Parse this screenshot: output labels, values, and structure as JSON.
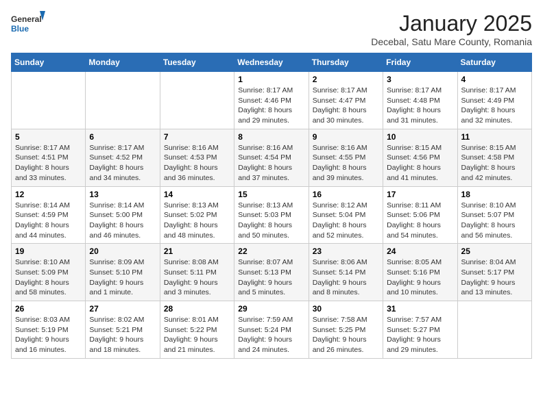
{
  "header": {
    "logo_general": "General",
    "logo_blue": "Blue",
    "title": "January 2025",
    "subtitle": "Decebal, Satu Mare County, Romania"
  },
  "days_of_week": [
    "Sunday",
    "Monday",
    "Tuesday",
    "Wednesday",
    "Thursday",
    "Friday",
    "Saturday"
  ],
  "weeks": [
    [
      {
        "day": "",
        "info": ""
      },
      {
        "day": "",
        "info": ""
      },
      {
        "day": "",
        "info": ""
      },
      {
        "day": "1",
        "info": "Sunrise: 8:17 AM\nSunset: 4:46 PM\nDaylight: 8 hours and 29 minutes."
      },
      {
        "day": "2",
        "info": "Sunrise: 8:17 AM\nSunset: 4:47 PM\nDaylight: 8 hours and 30 minutes."
      },
      {
        "day": "3",
        "info": "Sunrise: 8:17 AM\nSunset: 4:48 PM\nDaylight: 8 hours and 31 minutes."
      },
      {
        "day": "4",
        "info": "Sunrise: 8:17 AM\nSunset: 4:49 PM\nDaylight: 8 hours and 32 minutes."
      }
    ],
    [
      {
        "day": "5",
        "info": "Sunrise: 8:17 AM\nSunset: 4:51 PM\nDaylight: 8 hours and 33 minutes."
      },
      {
        "day": "6",
        "info": "Sunrise: 8:17 AM\nSunset: 4:52 PM\nDaylight: 8 hours and 34 minutes."
      },
      {
        "day": "7",
        "info": "Sunrise: 8:16 AM\nSunset: 4:53 PM\nDaylight: 8 hours and 36 minutes."
      },
      {
        "day": "8",
        "info": "Sunrise: 8:16 AM\nSunset: 4:54 PM\nDaylight: 8 hours and 37 minutes."
      },
      {
        "day": "9",
        "info": "Sunrise: 8:16 AM\nSunset: 4:55 PM\nDaylight: 8 hours and 39 minutes."
      },
      {
        "day": "10",
        "info": "Sunrise: 8:15 AM\nSunset: 4:56 PM\nDaylight: 8 hours and 41 minutes."
      },
      {
        "day": "11",
        "info": "Sunrise: 8:15 AM\nSunset: 4:58 PM\nDaylight: 8 hours and 42 minutes."
      }
    ],
    [
      {
        "day": "12",
        "info": "Sunrise: 8:14 AM\nSunset: 4:59 PM\nDaylight: 8 hours and 44 minutes."
      },
      {
        "day": "13",
        "info": "Sunrise: 8:14 AM\nSunset: 5:00 PM\nDaylight: 8 hours and 46 minutes."
      },
      {
        "day": "14",
        "info": "Sunrise: 8:13 AM\nSunset: 5:02 PM\nDaylight: 8 hours and 48 minutes."
      },
      {
        "day": "15",
        "info": "Sunrise: 8:13 AM\nSunset: 5:03 PM\nDaylight: 8 hours and 50 minutes."
      },
      {
        "day": "16",
        "info": "Sunrise: 8:12 AM\nSunset: 5:04 PM\nDaylight: 8 hours and 52 minutes."
      },
      {
        "day": "17",
        "info": "Sunrise: 8:11 AM\nSunset: 5:06 PM\nDaylight: 8 hours and 54 minutes."
      },
      {
        "day": "18",
        "info": "Sunrise: 8:10 AM\nSunset: 5:07 PM\nDaylight: 8 hours and 56 minutes."
      }
    ],
    [
      {
        "day": "19",
        "info": "Sunrise: 8:10 AM\nSunset: 5:09 PM\nDaylight: 8 hours and 58 minutes."
      },
      {
        "day": "20",
        "info": "Sunrise: 8:09 AM\nSunset: 5:10 PM\nDaylight: 9 hours and 1 minute."
      },
      {
        "day": "21",
        "info": "Sunrise: 8:08 AM\nSunset: 5:11 PM\nDaylight: 9 hours and 3 minutes."
      },
      {
        "day": "22",
        "info": "Sunrise: 8:07 AM\nSunset: 5:13 PM\nDaylight: 9 hours and 5 minutes."
      },
      {
        "day": "23",
        "info": "Sunrise: 8:06 AM\nSunset: 5:14 PM\nDaylight: 9 hours and 8 minutes."
      },
      {
        "day": "24",
        "info": "Sunrise: 8:05 AM\nSunset: 5:16 PM\nDaylight: 9 hours and 10 minutes."
      },
      {
        "day": "25",
        "info": "Sunrise: 8:04 AM\nSunset: 5:17 PM\nDaylight: 9 hours and 13 minutes."
      }
    ],
    [
      {
        "day": "26",
        "info": "Sunrise: 8:03 AM\nSunset: 5:19 PM\nDaylight: 9 hours and 16 minutes."
      },
      {
        "day": "27",
        "info": "Sunrise: 8:02 AM\nSunset: 5:21 PM\nDaylight: 9 hours and 18 minutes."
      },
      {
        "day": "28",
        "info": "Sunrise: 8:01 AM\nSunset: 5:22 PM\nDaylight: 9 hours and 21 minutes."
      },
      {
        "day": "29",
        "info": "Sunrise: 7:59 AM\nSunset: 5:24 PM\nDaylight: 9 hours and 24 minutes."
      },
      {
        "day": "30",
        "info": "Sunrise: 7:58 AM\nSunset: 5:25 PM\nDaylight: 9 hours and 26 minutes."
      },
      {
        "day": "31",
        "info": "Sunrise: 7:57 AM\nSunset: 5:27 PM\nDaylight: 9 hours and 29 minutes."
      },
      {
        "day": "",
        "info": ""
      }
    ]
  ]
}
